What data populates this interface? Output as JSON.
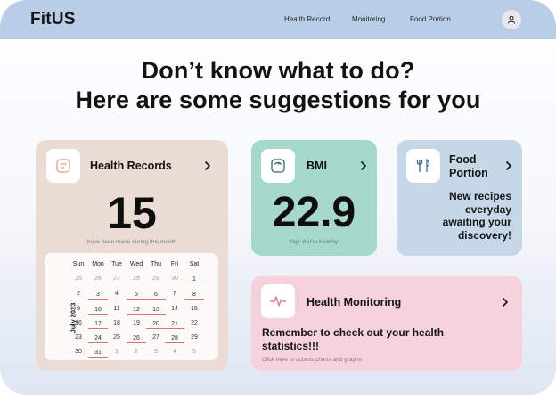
{
  "header": {
    "logo": "FitUS",
    "nav": [
      "Health Record",
      "Monitoring",
      "Food Portion"
    ],
    "avatar_icon": "user-icon"
  },
  "headline": {
    "line1": "Don’t know what to do?",
    "line2": "Here are some suggestions for you"
  },
  "health_records": {
    "title": "Health Records",
    "count": "15",
    "caption": "have been made during this month",
    "icon": "records-icon",
    "color": "#eadcd5"
  },
  "calendar": {
    "month": "July 2023",
    "weekdays": [
      "Sun",
      "Mon",
      "Tue",
      "Wed",
      "Thu",
      "Fri",
      "Sat"
    ],
    "weeks": [
      [
        "25",
        "26",
        "27",
        "28",
        "29",
        "30",
        "1"
      ],
      [
        "2",
        "3",
        "4",
        "5",
        "6",
        "7",
        "8"
      ],
      [
        "9",
        "10",
        "11",
        "12",
        "13",
        "14",
        "15"
      ],
      [
        "16",
        "17",
        "18",
        "19",
        "20",
        "21",
        "22"
      ],
      [
        "23",
        "24",
        "25",
        "26",
        "27",
        "28",
        "29"
      ],
      [
        "30",
        "31",
        "1",
        "2",
        "3",
        "4",
        "5"
      ]
    ]
  },
  "bmi": {
    "title": "BMI",
    "value": "22.9",
    "caption": "Yay! You're healthy!",
    "icon": "scale-icon",
    "color": "#a6d8cc"
  },
  "food": {
    "title_line1": "Food",
    "title_line2": "Portion",
    "message": [
      "New recipes",
      "everyday",
      "awaiting your",
      "discovery!"
    ],
    "icon": "fork-knife-icon",
    "color": "#c6d8e8"
  },
  "monitoring": {
    "title": "Health Monitoring",
    "message_line1": "Remember to check out your health",
    "message_line2": "statistics!!!",
    "caption": "Click here to access charts and graphs",
    "icon": "heartbeat-icon",
    "color": "#f6d3dc"
  }
}
